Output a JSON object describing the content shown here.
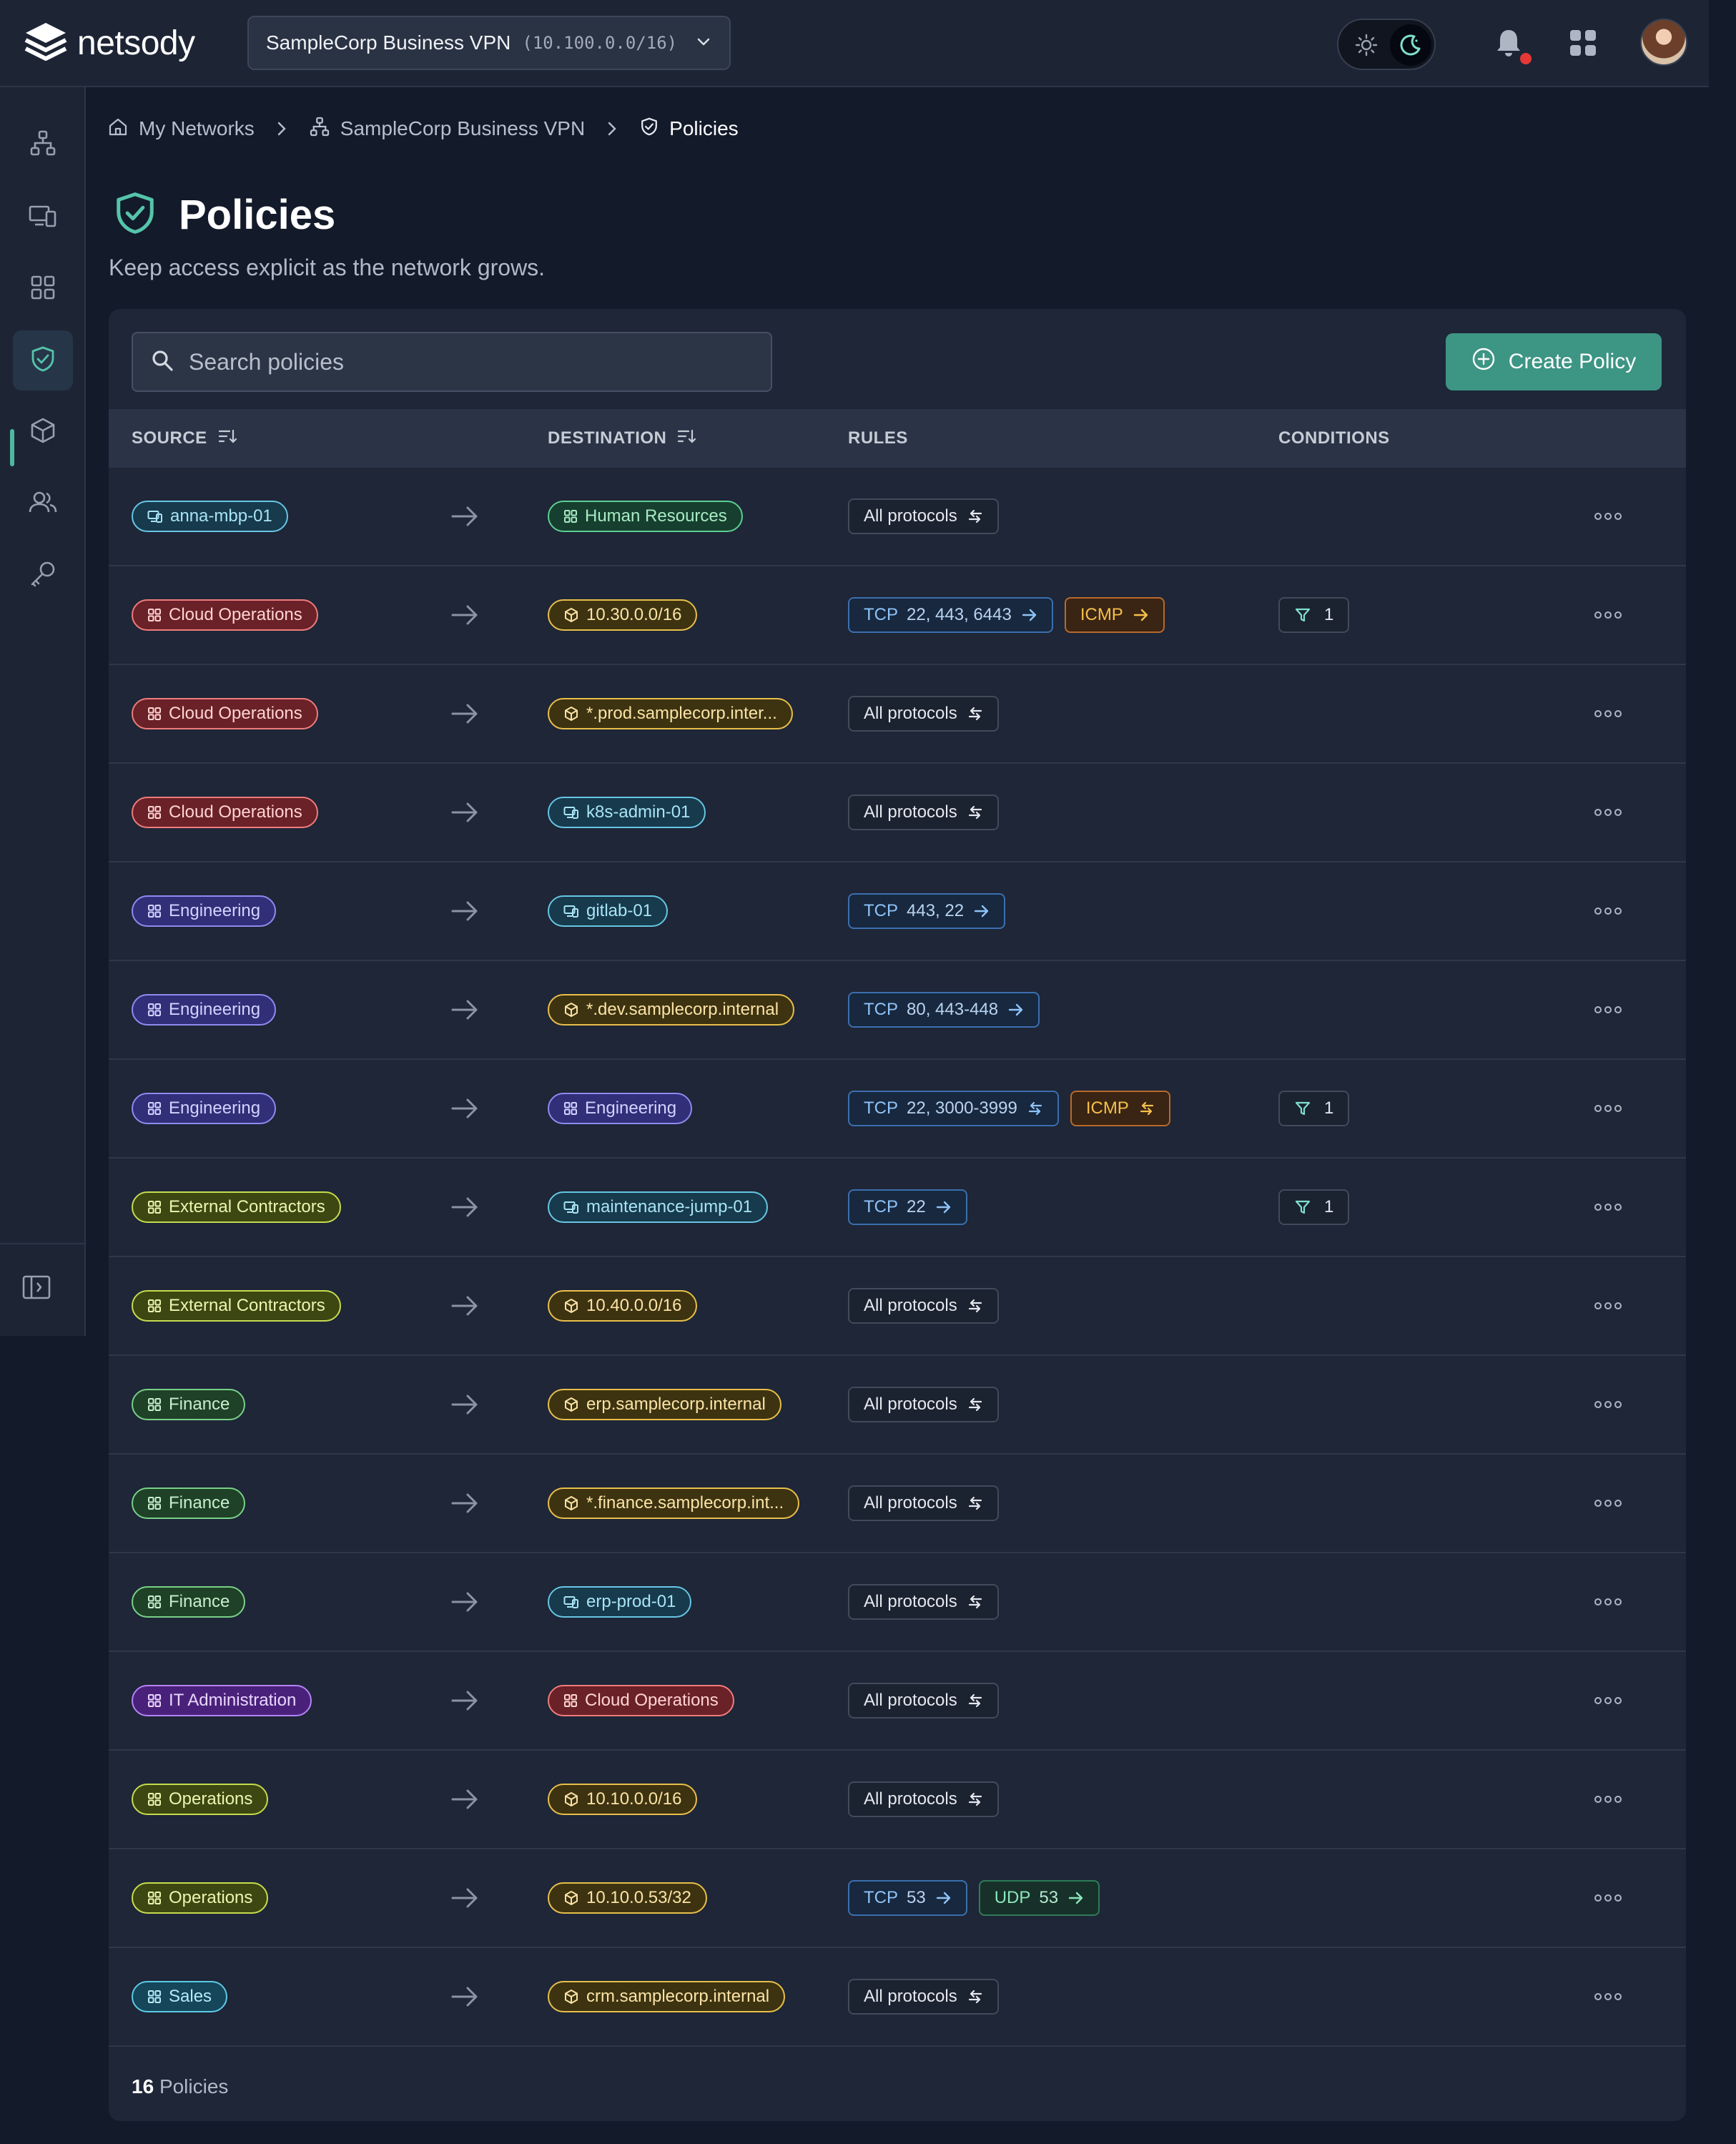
{
  "app": {
    "logo_text": "netsody"
  },
  "network_selector": {
    "name": "SampleCorp Business VPN",
    "cidr": "(10.100.0.0/16)"
  },
  "breadcrumb": {
    "home": "My Networks",
    "network": "SampleCorp Business VPN",
    "current": "Policies"
  },
  "page": {
    "title": "Policies",
    "subtitle": "Keep access explicit as the network grows."
  },
  "search": {
    "placeholder": "Search policies"
  },
  "create_button": {
    "label": "Create Policy"
  },
  "columns": {
    "source": "SOURCE",
    "destination": "DESTINATION",
    "rules": "RULES",
    "conditions": "CONDITIONS"
  },
  "colors": {
    "accent": "#3d9584",
    "background": "#131a2a",
    "panel": "#1e2637"
  },
  "policies": [
    {
      "source": {
        "label": "anna-mbp-01",
        "kind": "device",
        "color": "cyan"
      },
      "destination": {
        "label": "Human Resources",
        "kind": "group",
        "color": "green"
      },
      "rules": [
        {
          "type": "all",
          "label": "All protocols",
          "direction": "bidirectional"
        }
      ],
      "conditions": ""
    },
    {
      "source": {
        "label": "Cloud Operations",
        "kind": "group",
        "color": "red"
      },
      "destination": {
        "label": "10.30.0.0/16",
        "kind": "resource",
        "color": "yellow"
      },
      "rules": [
        {
          "type": "tcp",
          "label": "TCP",
          "ports": "22, 443, 6443",
          "direction": "outbound"
        },
        {
          "type": "icmp",
          "label": "ICMP",
          "ports": "",
          "direction": "outbound"
        }
      ],
      "conditions": "1"
    },
    {
      "source": {
        "label": "Cloud Operations",
        "kind": "group",
        "color": "red"
      },
      "destination": {
        "label": "*.prod.samplecorp.inter...",
        "kind": "resource",
        "color": "yellow"
      },
      "rules": [
        {
          "type": "all",
          "label": "All protocols",
          "direction": "bidirectional"
        }
      ],
      "conditions": ""
    },
    {
      "source": {
        "label": "Cloud Operations",
        "kind": "group",
        "color": "red"
      },
      "destination": {
        "label": "k8s-admin-01",
        "kind": "device",
        "color": "cyan"
      },
      "rules": [
        {
          "type": "all",
          "label": "All protocols",
          "direction": "bidirectional"
        }
      ],
      "conditions": ""
    },
    {
      "source": {
        "label": "Engineering",
        "kind": "group",
        "color": "indigo"
      },
      "destination": {
        "label": "gitlab-01",
        "kind": "device",
        "color": "cyan"
      },
      "rules": [
        {
          "type": "tcp",
          "label": "TCP",
          "ports": "443, 22",
          "direction": "outbound"
        }
      ],
      "conditions": ""
    },
    {
      "source": {
        "label": "Engineering",
        "kind": "group",
        "color": "indigo"
      },
      "destination": {
        "label": "*.dev.samplecorp.internal",
        "kind": "resource",
        "color": "yellow"
      },
      "rules": [
        {
          "type": "tcp",
          "label": "TCP",
          "ports": "80, 443-448",
          "direction": "outbound"
        }
      ],
      "conditions": ""
    },
    {
      "source": {
        "label": "Engineering",
        "kind": "group",
        "color": "indigo"
      },
      "destination": {
        "label": "Engineering",
        "kind": "group",
        "color": "indigo"
      },
      "rules": [
        {
          "type": "tcp",
          "label": "TCP",
          "ports": "22, 3000-3999",
          "direction": "bidirectional"
        },
        {
          "type": "icmp",
          "label": "ICMP",
          "ports": "",
          "direction": "bidirectional"
        }
      ],
      "conditions": "1"
    },
    {
      "source": {
        "label": "External Contractors",
        "kind": "group",
        "color": "lime"
      },
      "destination": {
        "label": "maintenance-jump-01",
        "kind": "device",
        "color": "cyan"
      },
      "rules": [
        {
          "type": "tcp",
          "label": "TCP",
          "ports": "22",
          "direction": "outbound"
        }
      ],
      "conditions": "1"
    },
    {
      "source": {
        "label": "External Contractors",
        "kind": "group",
        "color": "lime"
      },
      "destination": {
        "label": "10.40.0.0/16",
        "kind": "resource",
        "color": "yellow"
      },
      "rules": [
        {
          "type": "all",
          "label": "All protocols",
          "direction": "bidirectional"
        }
      ],
      "conditions": ""
    },
    {
      "source": {
        "label": "Finance",
        "kind": "group",
        "color": "fin"
      },
      "destination": {
        "label": "erp.samplecorp.internal",
        "kind": "resource",
        "color": "yellow"
      },
      "rules": [
        {
          "type": "all",
          "label": "All protocols",
          "direction": "bidirectional"
        }
      ],
      "conditions": ""
    },
    {
      "source": {
        "label": "Finance",
        "kind": "group",
        "color": "fin"
      },
      "destination": {
        "label": "*.finance.samplecorp.int...",
        "kind": "resource",
        "color": "yellow"
      },
      "rules": [
        {
          "type": "all",
          "label": "All protocols",
          "direction": "bidirectional"
        }
      ],
      "conditions": ""
    },
    {
      "source": {
        "label": "Finance",
        "kind": "group",
        "color": "fin"
      },
      "destination": {
        "label": "erp-prod-01",
        "kind": "device",
        "color": "cyan"
      },
      "rules": [
        {
          "type": "all",
          "label": "All protocols",
          "direction": "bidirectional"
        }
      ],
      "conditions": ""
    },
    {
      "source": {
        "label": "IT Administration",
        "kind": "group",
        "color": "purple"
      },
      "destination": {
        "label": "Cloud Operations",
        "kind": "group",
        "color": "red"
      },
      "rules": [
        {
          "type": "all",
          "label": "All protocols",
          "direction": "bidirectional"
        }
      ],
      "conditions": ""
    },
    {
      "source": {
        "label": "Operations",
        "kind": "group",
        "color": "lime"
      },
      "destination": {
        "label": "10.10.0.0/16",
        "kind": "resource",
        "color": "yellow"
      },
      "rules": [
        {
          "type": "all",
          "label": "All protocols",
          "direction": "bidirectional"
        }
      ],
      "conditions": ""
    },
    {
      "source": {
        "label": "Operations",
        "kind": "group",
        "color": "lime"
      },
      "destination": {
        "label": "10.10.0.53/32",
        "kind": "resource",
        "color": "yellow"
      },
      "rules": [
        {
          "type": "tcp",
          "label": "TCP",
          "ports": "53",
          "direction": "outbound"
        },
        {
          "type": "udp",
          "label": "UDP",
          "ports": "53",
          "direction": "outbound"
        }
      ],
      "conditions": ""
    },
    {
      "source": {
        "label": "Sales",
        "kind": "group",
        "color": "sales"
      },
      "destination": {
        "label": "crm.samplecorp.internal",
        "kind": "resource",
        "color": "yellow"
      },
      "rules": [
        {
          "type": "all",
          "label": "All protocols",
          "direction": "bidirectional"
        }
      ],
      "conditions": ""
    }
  ],
  "footer": {
    "count": "16",
    "label": "Policies"
  }
}
